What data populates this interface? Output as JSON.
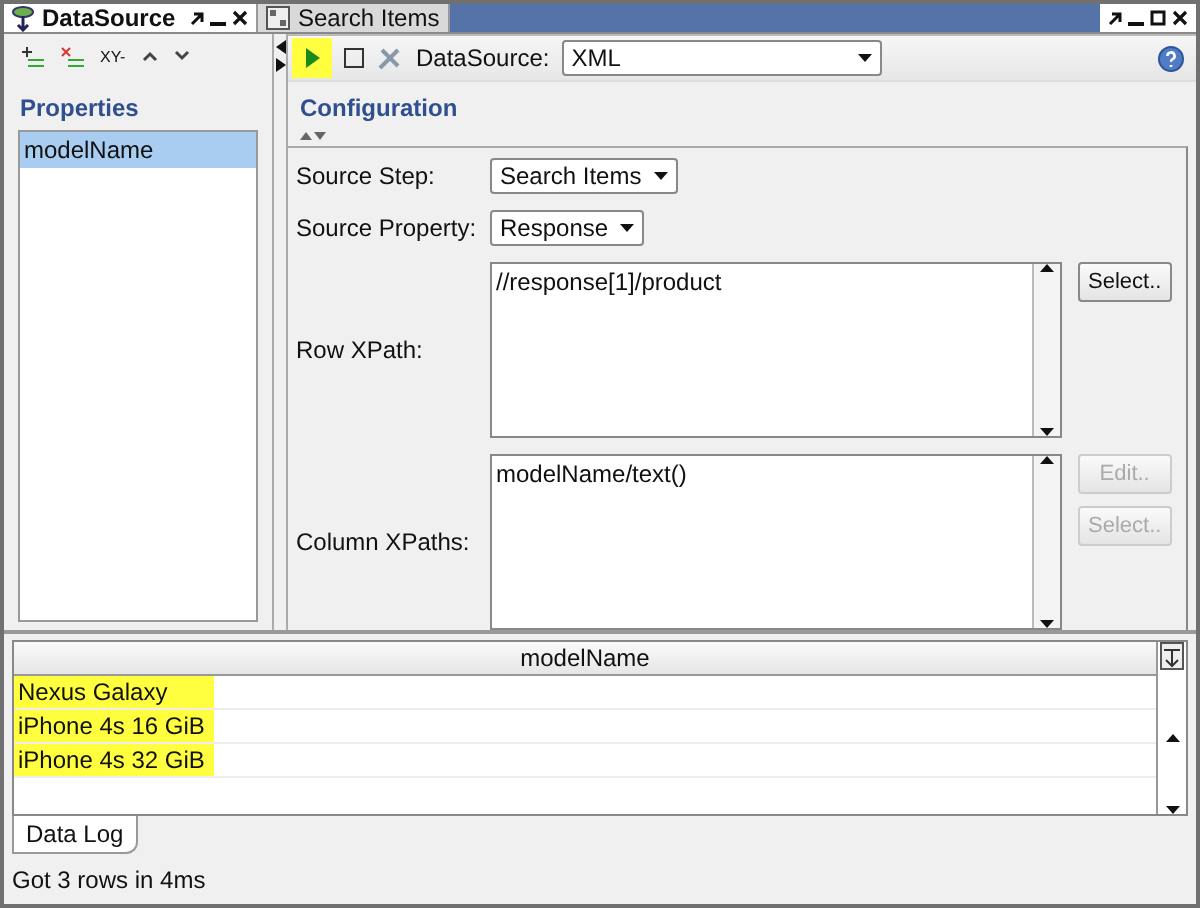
{
  "tabs": [
    {
      "label": "DataSource",
      "selected": true
    },
    {
      "label": "Search Items",
      "selected": false
    }
  ],
  "left_panel": {
    "xy_label": "XY-",
    "title": "Properties",
    "items": [
      {
        "label": "modelName",
        "selected": true
      }
    ]
  },
  "toolbar": {
    "run_highlighted": true,
    "datasource_label": "DataSource:",
    "datasource_value": "XML"
  },
  "config": {
    "title": "Configuration",
    "fields": [
      {
        "kind": "select",
        "label": "Source Step:",
        "value": "Search Items"
      },
      {
        "kind": "select",
        "label": "Source Property:",
        "value": "Response"
      },
      {
        "kind": "area",
        "label": "Row XPath:",
        "value": "//response[1]/product",
        "buttons": [
          {
            "label": "Select..",
            "disabled": false
          }
        ]
      },
      {
        "kind": "area",
        "label": "Column XPaths:",
        "value": "modelName/text()",
        "buttons": [
          {
            "label": "Edit..",
            "disabled": true
          },
          {
            "label": "Select..",
            "disabled": true
          }
        ]
      }
    ]
  },
  "table": {
    "columns": [
      "modelName"
    ],
    "rows": [
      {
        "cells": [
          "Nexus Galaxy"
        ],
        "highlighted": true
      },
      {
        "cells": [
          "iPhone 4s 16 GiB"
        ],
        "highlighted": true
      },
      {
        "cells": [
          "iPhone 4s 32 GiB"
        ],
        "highlighted": true
      }
    ]
  },
  "bottom_tabs": [
    {
      "label": "Data Log",
      "selected": true
    }
  ],
  "status_bar": "Got 3 rows in 4ms"
}
